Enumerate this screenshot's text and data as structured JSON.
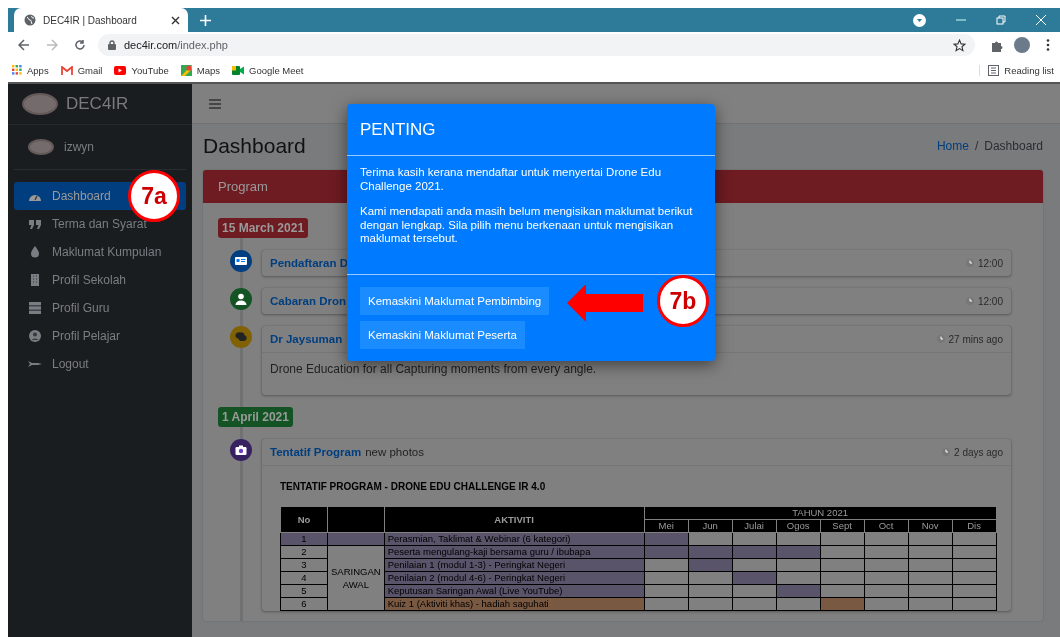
{
  "browser": {
    "tab_title": "DEC4IR | Dashboard",
    "url_host": "dec4ir.com",
    "url_path": "/index.php",
    "bookmarks": [
      {
        "label": "Apps"
      },
      {
        "label": "Gmail"
      },
      {
        "label": "YouTube"
      },
      {
        "label": "Maps"
      },
      {
        "label": "Google Meet"
      }
    ],
    "reading_list": "Reading list"
  },
  "sidebar": {
    "brand": "DEC4IR",
    "user": "izwyn",
    "items": [
      {
        "label": "Dashboard",
        "selected": true
      },
      {
        "label": "Terma dan Syarat",
        "selected": false
      },
      {
        "label": "Maklumat Kumpulan",
        "selected": false
      },
      {
        "label": "Profil Sekolah",
        "selected": false
      },
      {
        "label": "Profil Guru",
        "selected": false
      },
      {
        "label": "Profil Pelajar",
        "selected": false
      },
      {
        "label": "Logout",
        "selected": false
      }
    ]
  },
  "header": {
    "title": "Dashboard",
    "separator": "/",
    "breadcrumb": [
      {
        "label": "Home"
      },
      {
        "label": "Dashboard"
      }
    ]
  },
  "card": {
    "title": "Program",
    "timeline": [
      {
        "kind": "date",
        "label": "15 March 2021",
        "color": "#6e1b22"
      },
      {
        "kind": "item",
        "color": "#003e80",
        "title": "Pendaftaran D",
        "time": "12:00"
      },
      {
        "kind": "item",
        "color": "#145424",
        "title": "Cabaran Dron",
        "time": "12:00"
      },
      {
        "kind": "item",
        "color": "#806104",
        "title": "Dr Jaysuman",
        "time": "27 mins ago",
        "body": "Drone Education for all Capturing moments from every angle."
      },
      {
        "kind": "date",
        "label": "1 April 2021",
        "color": "#145424"
      },
      {
        "kind": "item",
        "color": "#382161",
        "title": "Tentatif Program",
        "text": "new photos",
        "time": "2 days ago",
        "gantt": true
      }
    ]
  },
  "gantt": {
    "title": "TENTATIF  PROGRAM - DRONE EDU CHALLENGE IR 4.0",
    "no": "No",
    "activity": "AKTIVITI",
    "year": "TAHUN 2021",
    "months": [
      "Mei",
      "Jun",
      "Julai",
      "Ogos",
      "Sept",
      "Oct",
      "Nov",
      "Dis"
    ],
    "group": "SARINGAN AWAL",
    "rows": [
      {
        "no": "1",
        "activity": "Perasmian, Taklimat & Webinar (6 kategori)",
        "in_group": false,
        "color": "#5a546b",
        "filled": [
          true,
          false,
          false,
          false,
          false,
          false,
          false,
          false
        ]
      },
      {
        "no": "2",
        "activity": "Peserta mengulang-kaji bersama guru / ibubapa",
        "in_group": true,
        "color": "#5a546b",
        "filled": [
          true,
          true,
          true,
          true,
          false,
          false,
          false,
          false
        ]
      },
      {
        "no": "3",
        "activity": "Penilaian 1 (modul 1-3) - Peringkat Negeri",
        "in_group": true,
        "color": "#5a546b",
        "filled": [
          false,
          true,
          false,
          false,
          false,
          false,
          false,
          false
        ]
      },
      {
        "no": "4",
        "activity": "Penilaian 2 (modul 4-6) - Peringkat Negeri",
        "in_group": true,
        "color": "#5a546b",
        "filled": [
          false,
          false,
          true,
          false,
          false,
          false,
          false,
          false
        ]
      },
      {
        "no": "5",
        "activity": "Keputusan Saringan Awal (Live YouTube)",
        "in_group": true,
        "color": "#5a546b",
        "filled": [
          false,
          false,
          false,
          true,
          false,
          false,
          false,
          false
        ]
      },
      {
        "no": "6",
        "activity": "Kuiz 1 (Aktiviti khas) - hadiah saguhati",
        "in_group": true,
        "color": "#7a5942",
        "filled": [
          false,
          false,
          false,
          false,
          true,
          false,
          false,
          false
        ]
      }
    ]
  },
  "modal": {
    "title": "PENTING",
    "paragraphs": [
      "Terima kasih kerana mendaftar untuk menyertai Drone Edu Challenge 2021.",
      "Kami mendapati anda masih belum mengisikan maklumat berikut dengan lengkap. Sila pilih menu berkenaan untuk mengisikan maklumat tersebut."
    ],
    "buttons": [
      {
        "label": "Kemaskini Maklumat Pembimbing"
      },
      {
        "label": "Kemaskini Maklumat Peserta"
      }
    ]
  },
  "callouts": [
    {
      "label": "7a"
    },
    {
      "label": "7b"
    }
  ]
}
